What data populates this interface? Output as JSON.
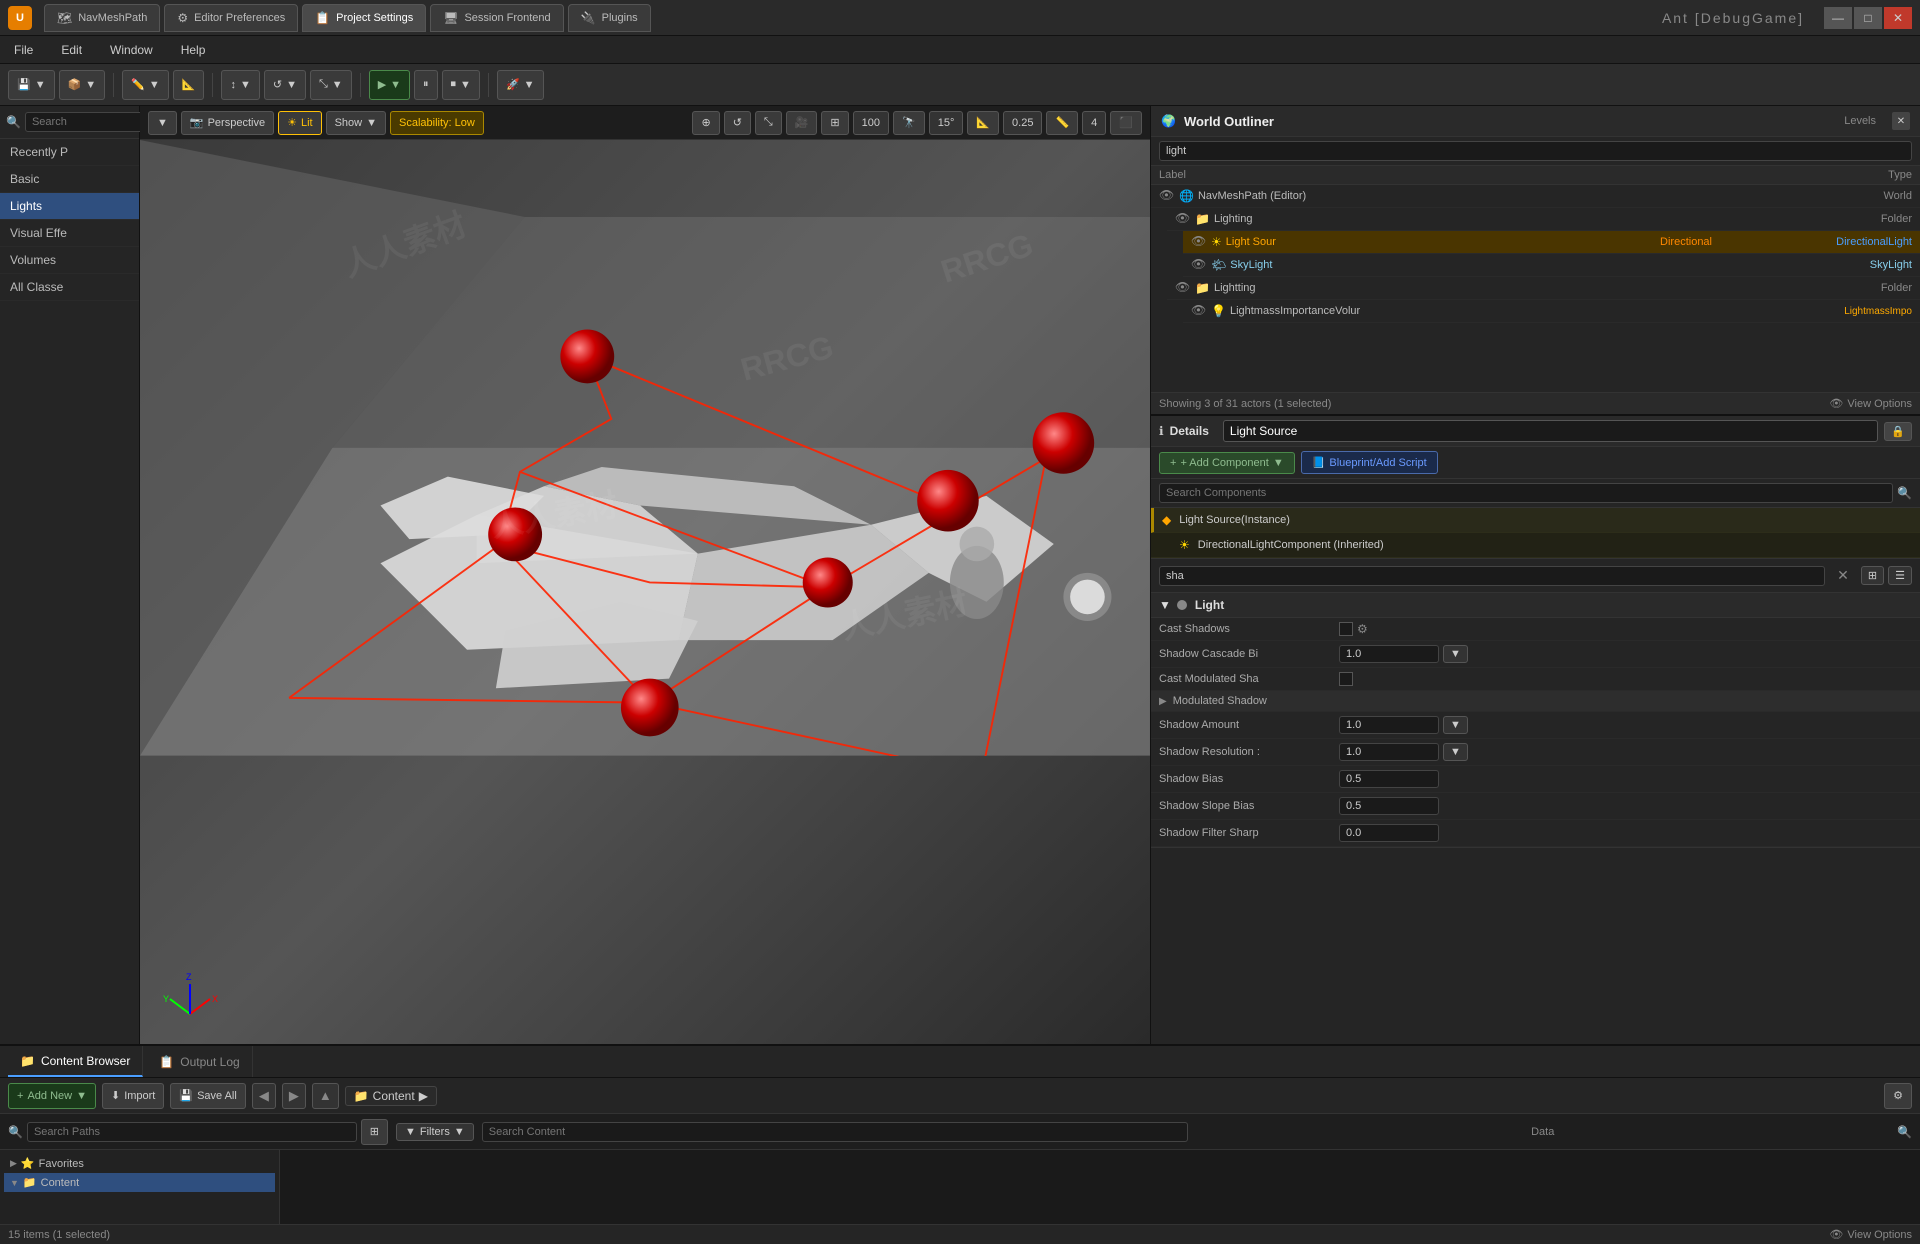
{
  "titlebar": {
    "logo": "U",
    "tabs": [
      {
        "label": "NavMeshPath",
        "icon": "🗺",
        "active": false
      },
      {
        "label": "Editor Preferences",
        "icon": "⚙",
        "active": false
      },
      {
        "label": "Project Settings",
        "icon": "📋",
        "active": false
      },
      {
        "label": "Session Frontend",
        "icon": "🖥",
        "active": false
      },
      {
        "label": "Plugins",
        "icon": "🔌",
        "active": false
      }
    ],
    "brand": "Ant [DebugGame]",
    "win_controls": [
      "—",
      "□",
      "✕"
    ]
  },
  "menu": {
    "items": [
      "File",
      "Edit",
      "Window",
      "Help"
    ]
  },
  "toolbar": {
    "save_label": "Save",
    "import_label": "Import"
  },
  "viewport": {
    "mode_label": "Perspective",
    "lit_label": "Lit",
    "show_label": "Show",
    "scalability_label": "Scalability: Low",
    "fov": "100",
    "angle": "15°",
    "scale": "0.25",
    "grid": "4"
  },
  "left_panel": {
    "search_placeholder": "Search",
    "items": [
      {
        "label": "Recently P",
        "active": false
      },
      {
        "label": "Basic",
        "active": false
      },
      {
        "label": "Lights",
        "active": true
      },
      {
        "label": "Visual Effe",
        "active": false
      },
      {
        "label": "Volumes",
        "active": false
      },
      {
        "label": "All Classe",
        "active": false
      }
    ]
  },
  "world_outliner": {
    "title": "World Outliner",
    "levels_tab": "Levels",
    "search_placeholder": "light",
    "col_label": "Label",
    "col_type": "Type",
    "items": [
      {
        "label": "NavMeshPath (Editor)",
        "type": "World",
        "indent": 0,
        "icon": "🌍"
      },
      {
        "label": "Lighting",
        "type": "Folder",
        "indent": 1,
        "icon": "📁"
      },
      {
        "label": "Light SourDirectional",
        "type": "DirectionalLight",
        "indent": 2,
        "icon": "☀",
        "selected": true,
        "highlighted": true
      },
      {
        "label": "SkyLight",
        "type": "SkyLight",
        "indent": 2,
        "icon": "🌤"
      },
      {
        "label": "Lightting",
        "type": "Folder",
        "indent": 1,
        "icon": "📁"
      },
      {
        "label": "LightmassImportanceVolur",
        "type": "LightmassImpo",
        "indent": 2,
        "icon": "💡"
      }
    ],
    "status": "Showing 3 of 31 actors (1 selected)",
    "view_options": "View Options"
  },
  "details": {
    "title": "Details",
    "instance_name": "Light Source",
    "add_component_label": "+ Add Component",
    "blueprint_label": "Blueprint/Add Script",
    "search_placeholder": "Search Components",
    "light_source_instance": "Light Source(Instance)",
    "directional_component": "DirectionalLightComponent (Inherited)"
  },
  "properties": {
    "search_value": "sha",
    "section": "Light",
    "rows": [
      {
        "label": "Cast Shadows",
        "type": "checkbox",
        "value": ""
      },
      {
        "label": "Shadow Cascade Bi",
        "type": "input",
        "value": "1.0"
      },
      {
        "label": "Cast Modulated Sha",
        "type": "checkbox",
        "value": ""
      },
      {
        "label": "Modulated Shadow",
        "type": "section"
      },
      {
        "label": "Shadow Amount",
        "type": "input",
        "value": "1.0"
      },
      {
        "label": "Shadow Resolution :",
        "type": "input",
        "value": "1.0"
      },
      {
        "label": "Shadow Bias",
        "type": "input",
        "value": "0.5"
      },
      {
        "label": "Shadow Slope Bias",
        "type": "input",
        "value": "0.5"
      },
      {
        "label": "Shadow Filter Sharp",
        "type": "input",
        "value": "0.0"
      }
    ]
  },
  "bottom": {
    "content_browser_tab": "Content Browser",
    "output_log_tab": "Output Log",
    "add_new_label": "Add New",
    "import_label": "Import",
    "save_all_label": "Save All",
    "path_label": "Content",
    "search_paths_placeholder": "Search Paths",
    "filters_label": "Filters",
    "search_content_placeholder": "Search Content",
    "data_label": "Data",
    "status_text": "15 items (1 selected)",
    "view_options": "View Options",
    "tree_items": [
      {
        "label": "Favorites",
        "icon": "⭐"
      },
      {
        "label": "Content",
        "icon": "📁",
        "active": true
      }
    ]
  }
}
